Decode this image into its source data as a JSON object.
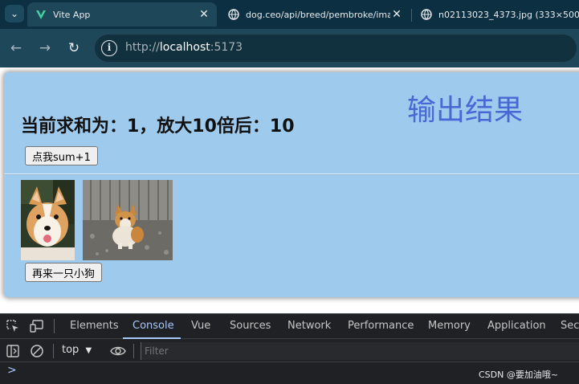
{
  "browser": {
    "tabs": [
      {
        "title": "Vite App",
        "favicon": "vite-icon",
        "active": true
      },
      {
        "title": "dog.ceo/api/breed/pembroke/ima",
        "favicon": "globe-icon",
        "active": false
      },
      {
        "title": "n02113023_4373.jpg (333×500)",
        "favicon": "globe-icon",
        "active": false
      }
    ],
    "address": {
      "scheme": "http://",
      "host": "localhost",
      "port": ":5173"
    }
  },
  "page": {
    "sum_heading": "当前求和为：1，放大10倍后：10",
    "overlay_text": "输出结果",
    "sum_button_label": "点我sum+1",
    "dog_button_label": "再来一只小狗"
  },
  "devtools": {
    "tabs": [
      "Elements",
      "Console",
      "Vue",
      "Sources",
      "Network",
      "Performance",
      "Memory",
      "Application",
      "Secu"
    ],
    "active_tab": "Console",
    "context": "top",
    "filter_placeholder": "Filter",
    "prompt": ">"
  },
  "watermark": "CSDN @要加油哦~",
  "colors": {
    "tab_strip": "#0c2f41",
    "toolbar": "#1e4759",
    "card_background": "#9ecbed",
    "overlay_text": "#4a67d6",
    "devtools_background": "#202124",
    "devtools_accent": "#a8c7fa"
  }
}
